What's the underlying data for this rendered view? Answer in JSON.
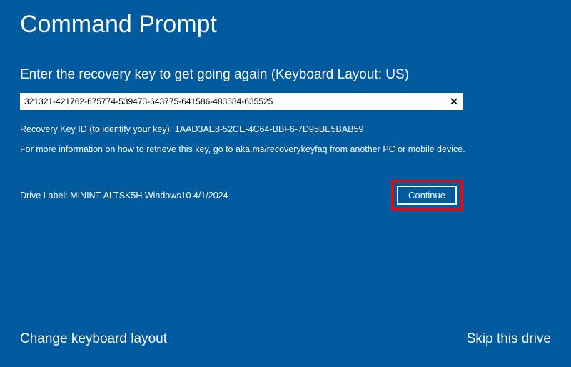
{
  "title": "Command Prompt",
  "instruction": "Enter the recovery key to get going again (Keyboard Layout: US)",
  "recovery_input": {
    "value": "321321-421762-675774-539473-643775-641586-483384-635525",
    "clear_symbol": "✕"
  },
  "key_id_text": "Recovery Key ID (to identify your key): 1AAD3AE8-52CE-4C64-BBF6-7D95BE5BAB59",
  "more_info_text": "For more information on how to retrieve this key, go to aka.ms/recoverykeyfaq from another PC or mobile device.",
  "drive_label_text": "Drive Label: MININT-ALTSK5H Windows10 4/1/2024",
  "continue_label": "Continue",
  "bottom": {
    "change_layout": "Change keyboard layout",
    "skip_drive": "Skip this drive"
  }
}
